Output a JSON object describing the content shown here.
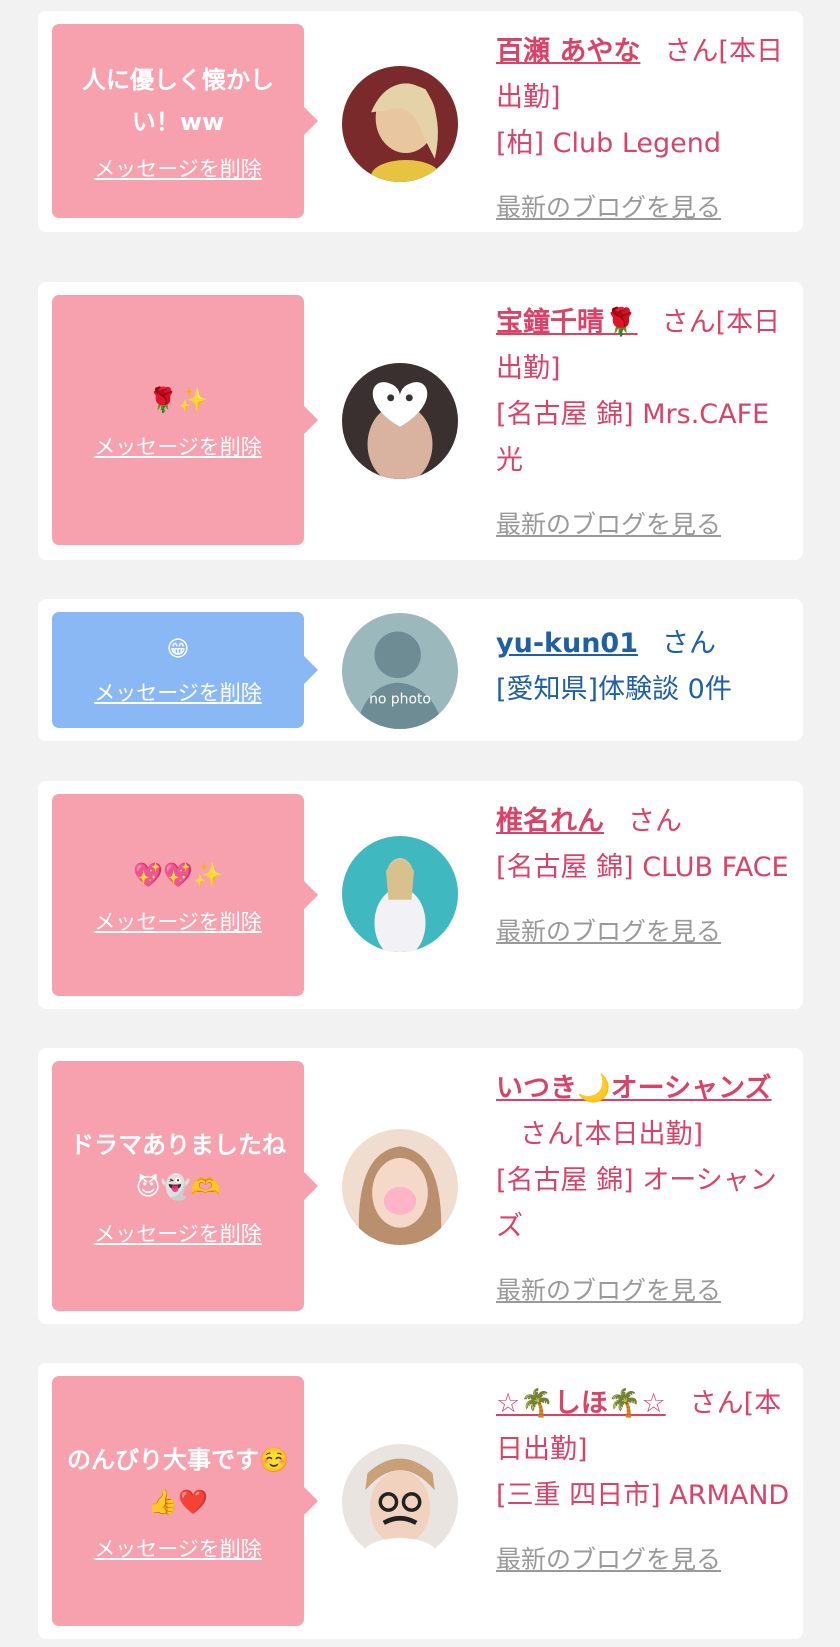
{
  "cards": [
    {
      "message": "人に優しく懐かしい！ww",
      "delete_label": "メッセージを削除",
      "name": "百瀬 あやな",
      "suffix": "さん[本日出勤]",
      "shop": "[柏] Club Legend",
      "blog_label": "最新のブログを見る"
    },
    {
      "message": "🌹✨",
      "delete_label": "メッセージを削除",
      "name": "宝鐘千晴🌹",
      "suffix": "さん[本日出勤]",
      "shop": "[名古屋 錦] Mrs.CAFE 光",
      "blog_label": "最新のブログを見る"
    },
    {
      "message": "😁",
      "delete_label": "メッセージを削除",
      "name": "yu-kun01",
      "suffix": "さん",
      "shop": "[愛知県]体験談 0件",
      "avatar_text": "no photo"
    },
    {
      "message": "💖💖✨",
      "delete_label": "メッセージを削除",
      "name": "椎名れん",
      "suffix": "さん",
      "shop": "[名古屋 錦] CLUB FACE",
      "blog_label": "最新のブログを見る"
    },
    {
      "message": "ドラマありましたね😈👻🫶",
      "delete_label": "メッセージを削除",
      "name": "いつき🌙オーシャンズ",
      "suffix": "さん[本日出勤]",
      "shop": "[名古屋 錦] オーシャンズ",
      "blog_label": "最新のブログを見る"
    },
    {
      "message": "のんびり大事です☺️👍❤️",
      "delete_label": "メッセージを削除",
      "name": "☆🌴しほ🌴☆",
      "suffix": "さん[本日出勤]",
      "shop": "[三重 四日市] ARMAND",
      "blog_label": "最新のブログを見る"
    }
  ],
  "colors": {
    "bubble_pink": "#f7a0ae",
    "bubble_blue": "#8ab8f5",
    "cast_text": "#d9436a",
    "user_text": "#1f5fa6",
    "blog_link": "#999999",
    "background": "#f2f2f2"
  }
}
